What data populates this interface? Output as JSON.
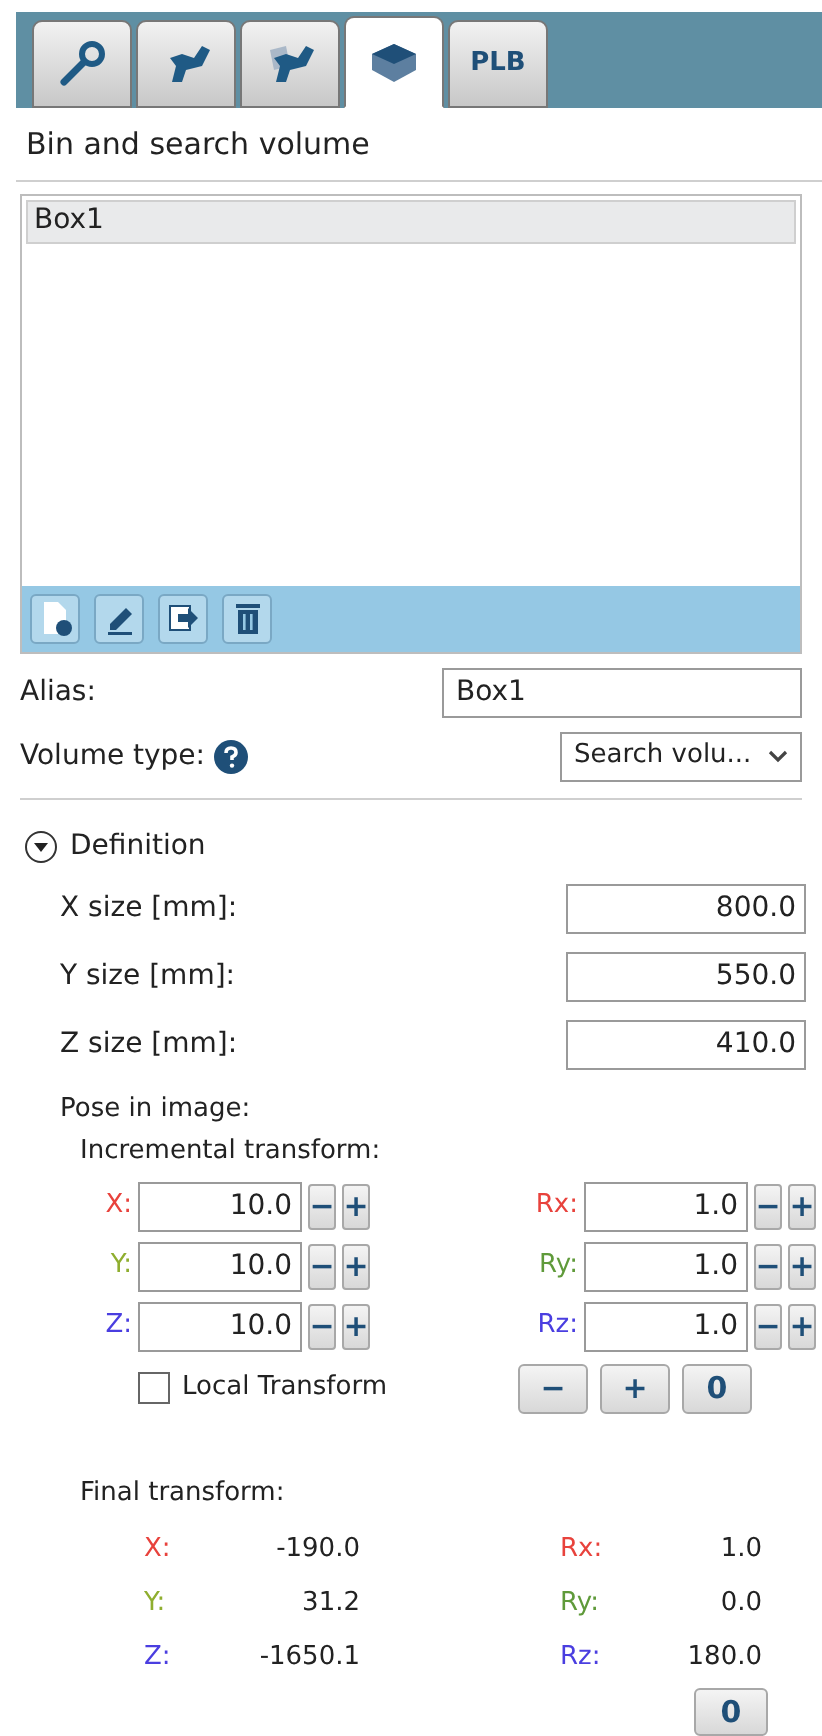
{
  "tabs": [
    {
      "kind": "icon",
      "selected": false
    },
    {
      "kind": "icon",
      "selected": false
    },
    {
      "kind": "icon",
      "selected": false
    },
    {
      "kind": "icon",
      "selected": true
    },
    {
      "kind": "text",
      "label": "PLB",
      "selected": false
    }
  ],
  "title": "Bin and search volume",
  "list": {
    "items": [
      {
        "label": "Box1",
        "selected": true
      }
    ]
  },
  "alias": {
    "label": "Alias:",
    "value": "Box1"
  },
  "volume_type": {
    "label": "Volume type:",
    "value": "Search volu..."
  },
  "definition": {
    "label": "Definition",
    "expanded": true,
    "sizes": [
      {
        "label": "X size [mm]:",
        "value": "800.0"
      },
      {
        "label": "Y size [mm]:",
        "value": "550.0"
      },
      {
        "label": "Z size [mm]:",
        "value": "410.0"
      }
    ],
    "pose_label": "Pose in image:",
    "incremental": {
      "label": "Incremental transform:",
      "rows": [
        {
          "left": {
            "label": "X:",
            "color": "#e8423c",
            "value": "10.0"
          },
          "right": {
            "label": "Rx:",
            "color": "#e8423c",
            "value": "1.0"
          }
        },
        {
          "left": {
            "label": "Y:",
            "color": "#8fae2f",
            "value": "10.0"
          },
          "right": {
            "label": "Ry:",
            "color": "#5f9a3a",
            "value": "1.0"
          }
        },
        {
          "left": {
            "label": "Z:",
            "color": "#4a3ee0",
            "value": "10.0"
          },
          "right": {
            "label": "Rz:",
            "color": "#4a3ee0",
            "value": "1.0"
          }
        }
      ],
      "minus": "−",
      "plus": "+",
      "local_transform": {
        "label": "Local Transform",
        "checked": false
      },
      "buttons": [
        "−",
        "+",
        "0"
      ]
    },
    "final": {
      "label": "Final transform:",
      "rows": [
        {
          "left": {
            "label": "X:",
            "color": "#e8423c",
            "value": "-190.0"
          },
          "right": {
            "label": "Rx:",
            "color": "#e8423c",
            "value": "1.0"
          }
        },
        {
          "left": {
            "label": "Y:",
            "color": "#8fae2f",
            "value": "31.2"
          },
          "right": {
            "label": "Ry:",
            "color": "#5f9a3a",
            "value": "0.0"
          }
        },
        {
          "left": {
            "label": "Z:",
            "color": "#4a3ee0",
            "value": "-1650.1"
          },
          "right": {
            "label": "Rz:",
            "color": "#4a3ee0",
            "value": "180.0"
          }
        }
      ],
      "button": "0"
    }
  }
}
